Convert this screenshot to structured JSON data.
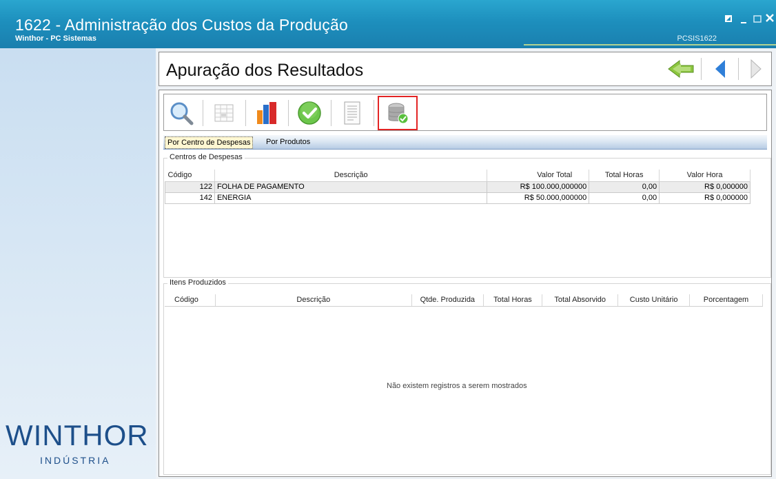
{
  "window": {
    "title": "1622 - Administração dos Custos da Produção",
    "subtitle": "Winthor - PC Sistemas",
    "routine_code": "PCSIS1622"
  },
  "logo": {
    "main": "WINTHOR",
    "sub": "INDÚSTRIA"
  },
  "header": {
    "title": "Apuração dos Resultados"
  },
  "toolbar": {
    "buttons": [
      "search-icon",
      "grid-icon",
      "chart-icon",
      "check-icon",
      "report-icon",
      "database-check-icon"
    ]
  },
  "tabs": [
    "Por Centro de Despesas",
    "Por Produtos"
  ],
  "centros": {
    "label": "Centros de Despesas",
    "columns": [
      "Código",
      "Descrição",
      "Valor Total",
      "Total Horas",
      "Valor Hora"
    ],
    "rows": [
      [
        "122",
        "FOLHA DE PAGAMENTO",
        "R$ 100.000,000000",
        "0,00",
        "R$ 0,000000"
      ],
      [
        "142",
        "ENERGIA",
        "R$ 50.000,000000",
        "0,00",
        "R$ 0,000000"
      ]
    ]
  },
  "itens": {
    "label": "Itens Produzidos",
    "columns": [
      "Código",
      "Descrição",
      "Qtde. Produzida",
      "Total Horas",
      "Total Absorvido",
      "Custo Unitário",
      "Porcentagem"
    ],
    "empty_message": "Não existem registros a serem mostrados"
  },
  "colors": {
    "titlebar": "#1d8fbd",
    "selection_border": "#e32424",
    "tab_active": "#fff7d2"
  }
}
